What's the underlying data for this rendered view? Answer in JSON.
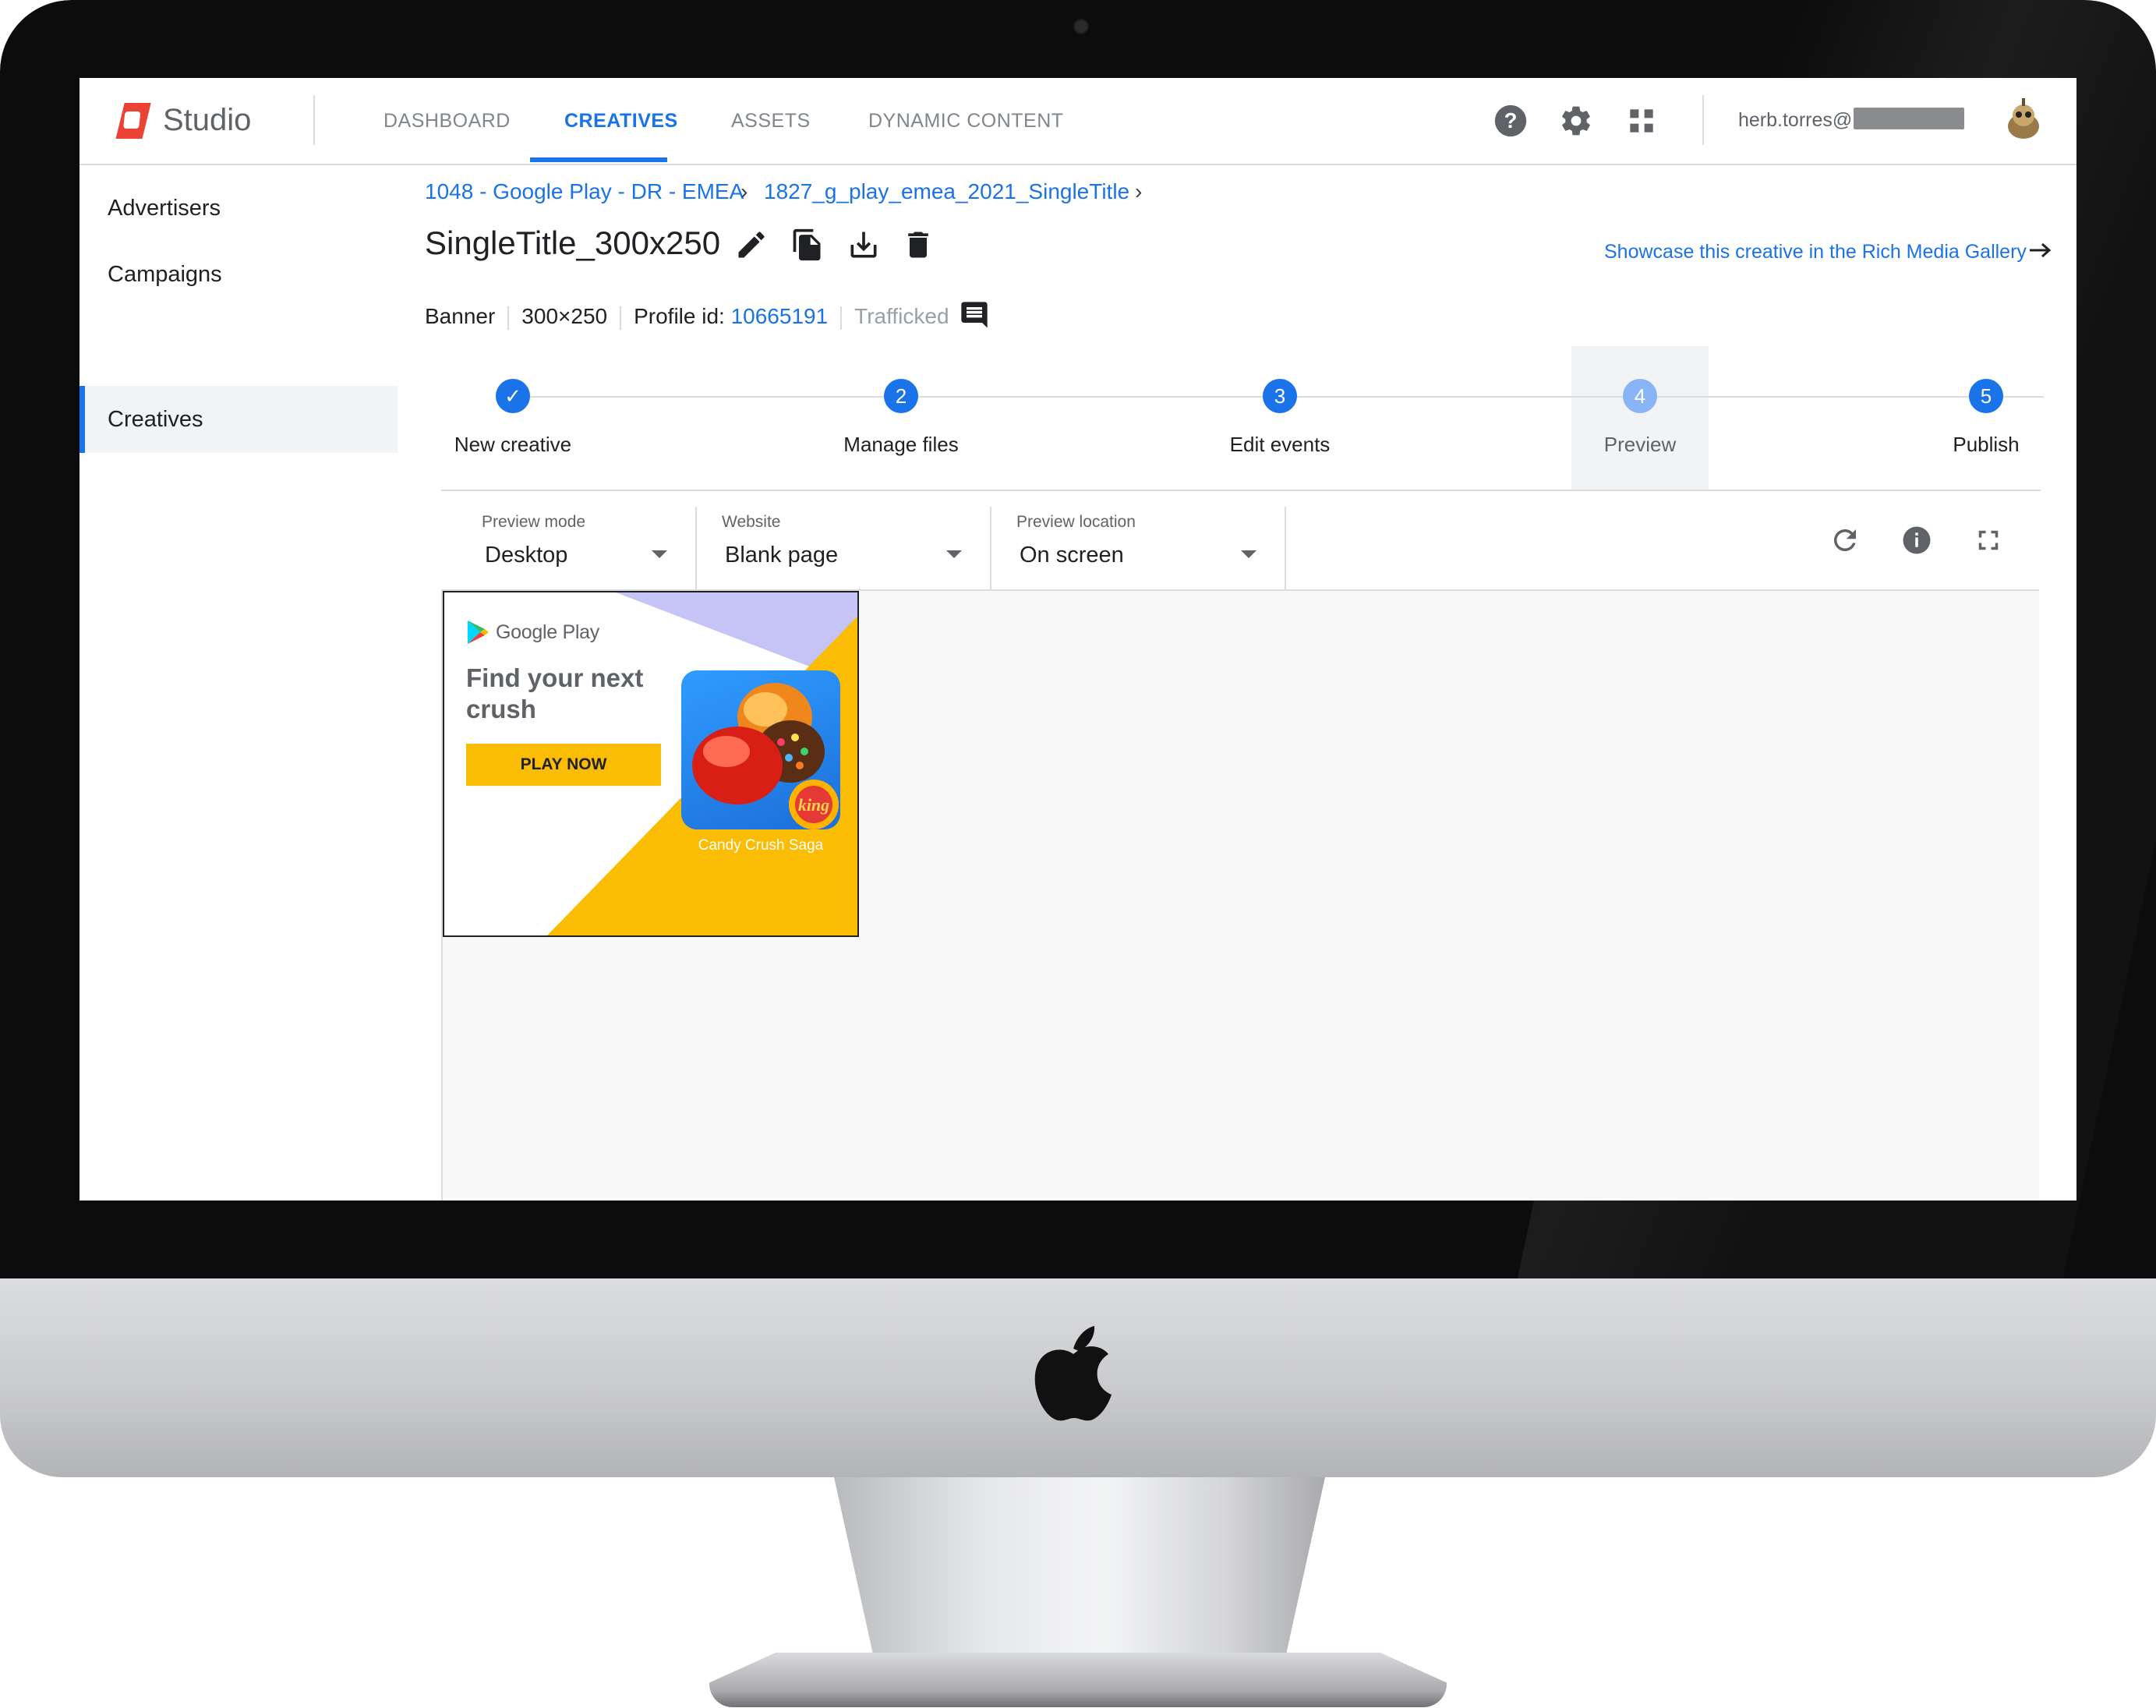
{
  "header": {
    "app_name": "Studio",
    "tabs": [
      {
        "label": "DASHBOARD",
        "active": false
      },
      {
        "label": "CREATIVES",
        "active": true
      },
      {
        "label": "ASSETS",
        "active": false
      },
      {
        "label": "DYNAMIC CONTENT",
        "active": false
      }
    ],
    "icons": [
      "help-icon",
      "settings-icon",
      "apps-grid-icon"
    ],
    "user_email_prefix": "herb.torres@",
    "accent_color": "#1a73e8"
  },
  "sidebar": {
    "items": [
      {
        "label": "Advertisers",
        "active": false
      },
      {
        "label": "Campaigns",
        "active": false
      },
      {
        "label": "Creatives",
        "active": true
      }
    ]
  },
  "breadcrumb": {
    "items": [
      "1048 - Google Play - DR - EMEA",
      "1827_g_play_emea_2021_SingleTitle"
    ]
  },
  "creative": {
    "title": "SingleTitle_300x250",
    "showcase_link": "Showcase this creative in the Rich Media Gallery",
    "format": "Banner",
    "size": "300×250",
    "profile_label": "Profile id:",
    "profile_id": "10665191",
    "status": "Trafficked"
  },
  "stepper": {
    "steps": [
      {
        "number": "✓",
        "label": "New creative",
        "state": "done"
      },
      {
        "number": "2",
        "label": "Manage files",
        "state": "default"
      },
      {
        "number": "3",
        "label": "Edit events",
        "state": "default"
      },
      {
        "number": "4",
        "label": "Preview",
        "state": "current"
      },
      {
        "number": "5",
        "label": "Publish",
        "state": "default"
      }
    ]
  },
  "preview_toolbar": {
    "preview_mode": {
      "label": "Preview mode",
      "value": "Desktop"
    },
    "website": {
      "label": "Website",
      "value": "Blank page"
    },
    "preview_location": {
      "label": "Preview location",
      "value": "On screen"
    }
  },
  "banner_ad": {
    "brand": "Google Play",
    "headline": "Find your next crush",
    "cta": "PLAY NOW",
    "game_name": "Candy Crush Saga",
    "colors": {
      "yellow": "#fbbc04",
      "purple": "#c6c4f7"
    }
  }
}
